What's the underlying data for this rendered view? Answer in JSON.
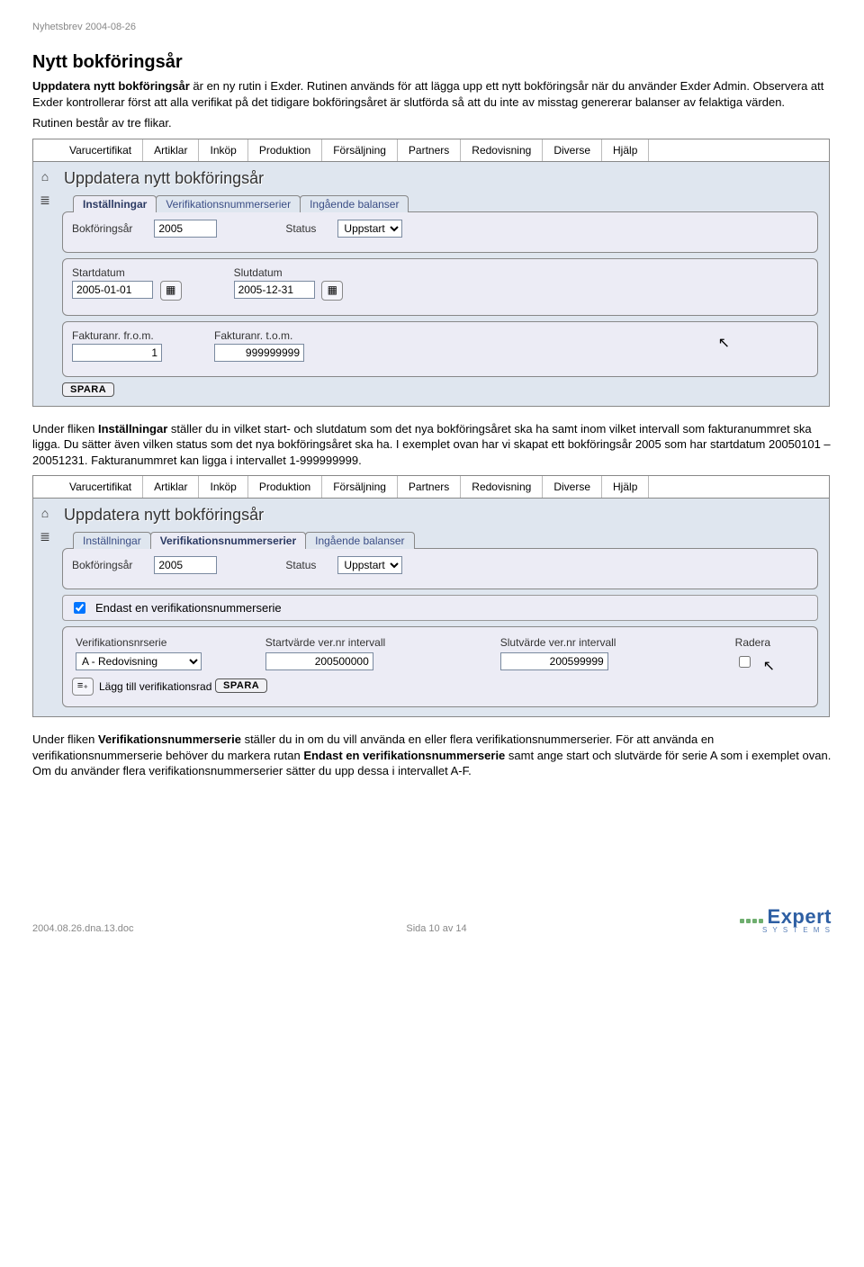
{
  "header": {
    "small": "Nyhetsbrev 2004-08-26"
  },
  "title": "Nytt bokföringsår",
  "intro": {
    "p1_a": "Uppdatera nytt bokföringsår",
    "p1_b": " är en ny rutin i Exder. Rutinen används för att lägga upp ett nytt bokföringsår när du använder Exder Admin. Observera att Exder kontrollerar först att alla verifikat på det tidigare bokföringsåret är slutförda så att du inte av misstag genererar balanser av felaktiga värden.",
    "p2": "Rutinen består av tre flikar."
  },
  "menus": [
    "Varucertifikat",
    "Artiklar",
    "Inköp",
    "Produktion",
    "Försäljning",
    "Partners",
    "Redovisning",
    "Diverse",
    "Hjälp"
  ],
  "app_title": "Uppdatera nytt bokföringsår",
  "tabs": {
    "settings": "Inställningar",
    "series": "Verifikationsnummerserier",
    "balances": "Ingående balanser"
  },
  "shot1": {
    "bokforingsar_label": "Bokföringsår",
    "bokforingsar_value": "2005",
    "status_label": "Status",
    "status_value": "Uppstart",
    "start_label": "Startdatum",
    "start_value": "2005-01-01",
    "slut_label": "Slutdatum",
    "slut_value": "2005-12-31",
    "faknr_from_label": "Fakturanr. fr.o.m.",
    "faknr_from_value": "1",
    "faknr_to_label": "Fakturanr. t.o.m.",
    "faknr_to_value": "999999999",
    "save": "SPARA"
  },
  "mid": {
    "p_a": "Under fliken ",
    "p_b": "Inställningar",
    "p_c": " ställer du in vilket start- och slutdatum som det nya bokföringsåret ska ha samt inom vilket intervall som fakturanummret ska ligga. Du sätter även vilken status som det nya bokföringsåret ska ha. I exemplet ovan har vi skapat ett bokföringsår 2005 som har startdatum 20050101 – 20051231. Fakturanummret kan ligga i intervallet 1-999999999."
  },
  "shot2": {
    "bokforingsar_label": "Bokföringsår",
    "bokforingsar_value": "2005",
    "status_label": "Status",
    "status_value": "Uppstart",
    "only_one_label": "Endast en verifikationsnummerserie",
    "col_series": "Verifikationsnrserie",
    "col_start": "Startvärde ver.nr intervall",
    "col_end": "Slutvärde ver.nr intervall",
    "col_del": "Radera",
    "series_value": "A - Redovisning",
    "start_value": "200500000",
    "end_value": "200599999",
    "add_row": "Lägg till verifikationsrad",
    "save": "SPARA"
  },
  "bottom": {
    "p_a": "Under fliken ",
    "p_b": "Verifikationsnummerserie",
    "p_c": " ställer du in om du vill använda en eller flera verifikationsnummerserier. För att använda en verifikationsnummerserie behöver du markera rutan ",
    "p_d": "Endast en verifikationsnummerserie",
    "p_e": " samt ange start och slutvärde för serie A som i exemplet ovan. Om du använder flera verifikationsnummerserier sätter du upp dessa i intervallet A-F."
  },
  "footer": {
    "left": "2004.08.26.dna.13.doc",
    "center": "Sida 10 av 14",
    "logo_big": "Expert",
    "logo_small": "S Y S T E M S"
  }
}
